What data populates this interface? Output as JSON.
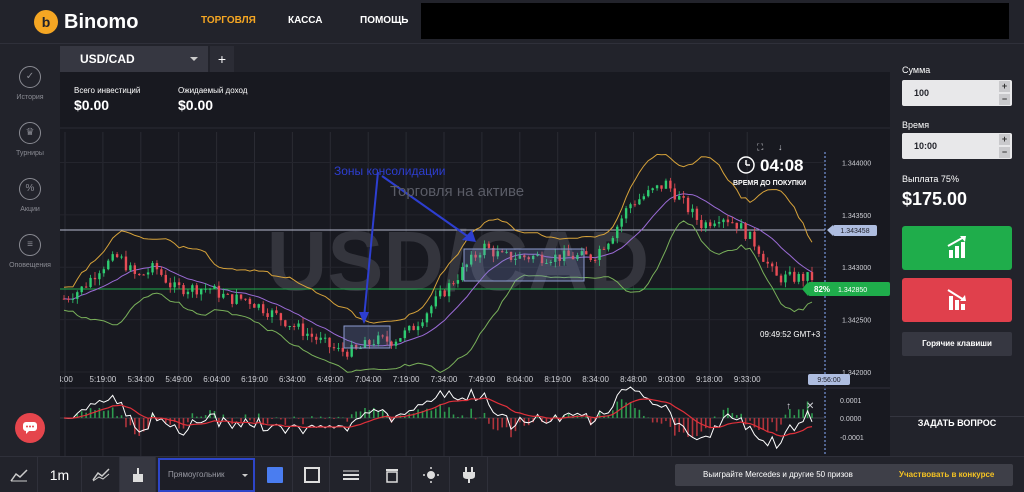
{
  "brand": {
    "name": "Binomo",
    "logo_letter": "b"
  },
  "topnav": {
    "trading": "ТОРГОВЛЯ",
    "cashier": "КАССА",
    "help": "ПОМОЩЬ"
  },
  "sidebar": {
    "items": [
      {
        "label": "История",
        "icon": "check-circle-icon"
      },
      {
        "label": "Турниры",
        "icon": "trophy-icon"
      },
      {
        "label": "Акции",
        "icon": "percent-icon"
      },
      {
        "label": "Оповещения",
        "icon": "menu-lines-icon"
      }
    ]
  },
  "tab": {
    "asset": "USD/CAD",
    "add": "+"
  },
  "stats": {
    "investments_label": "Всего инвестиций",
    "investments_value": "$0.00",
    "income_label": "Ожидаемый доход",
    "income_value": "$0.00"
  },
  "timer": {
    "value": "04:08",
    "label": "ВРЕМЯ ДО ПОКУПКИ"
  },
  "annotations": {
    "zones": "Зоны консолидации",
    "trading": "Торговля на активе"
  },
  "watermark": "USD/CAD",
  "server_time": "09:49:52 GMT+3",
  "chart_data": {
    "type": "candlestick",
    "title": "USD/CAD",
    "x_ticks": [
      "4:00",
      "5:19:00",
      "5:34:00",
      "5:49:00",
      "6:04:00",
      "6:19:00",
      "6:34:00",
      "6:49:00",
      "7:04:00",
      "7:19:00",
      "7:34:00",
      "7:49:00",
      "8:04:00",
      "8:19:00",
      "8:34:00",
      "8:48:00",
      "9:03:00",
      "9:18:00",
      "9:33:00"
    ],
    "y_ticks": [
      "1.344000",
      "1.343500",
      "1.343000",
      "1.342500",
      "1.342000"
    ],
    "y_range": [
      1.342,
      1.3441
    ],
    "current_price": "1.342850",
    "payout_tag": "82%",
    "level_line": "1.343458",
    "expiry_time": "9:56:00",
    "close_series": [
      1.3427,
      1.3428,
      1.343,
      1.3431,
      1.3429,
      1.343,
      1.3428,
      1.3428,
      1.3428,
      1.3427,
      1.3427,
      1.3426,
      1.3425,
      1.3424,
      1.3423,
      1.3422,
      1.3422,
      1.3423,
      1.3423,
      1.3424,
      1.3426,
      1.3428,
      1.343,
      1.3432,
      1.3431,
      1.3431,
      1.3431,
      1.3431,
      1.3431,
      1.3431,
      1.3433,
      1.3436,
      1.3437,
      1.3438,
      1.3436,
      1.3434,
      1.3435,
      1.3434,
      1.3432,
      1.3429,
      1.3429,
      1.3429
    ],
    "oscillator": {
      "y_ticks": [
        "0.0001",
        "0.0000",
        "-0.0001"
      ]
    }
  },
  "right_panel": {
    "amount_label": "Сумма",
    "amount_value": "100",
    "time_label": "Время",
    "time_value": "10:00",
    "payout_label": "Выплата 75%",
    "payout_amount": "$175.00",
    "hotkeys": "Горячие клавиши",
    "ask": "ЗАДАТЬ ВОПРОС"
  },
  "bottom": {
    "timeframe": "1m",
    "shape": "Прямоугольник",
    "promo_text": "Выиграйте Mercedes и другие 50 призов",
    "promo_link": "Участвовать в конкурсе"
  },
  "colors": {
    "accent": "#f5a623",
    "up": "#1fad4b",
    "down": "#e0404c",
    "price_tag": "#1fad4b",
    "level_tag": "#aebde0"
  }
}
